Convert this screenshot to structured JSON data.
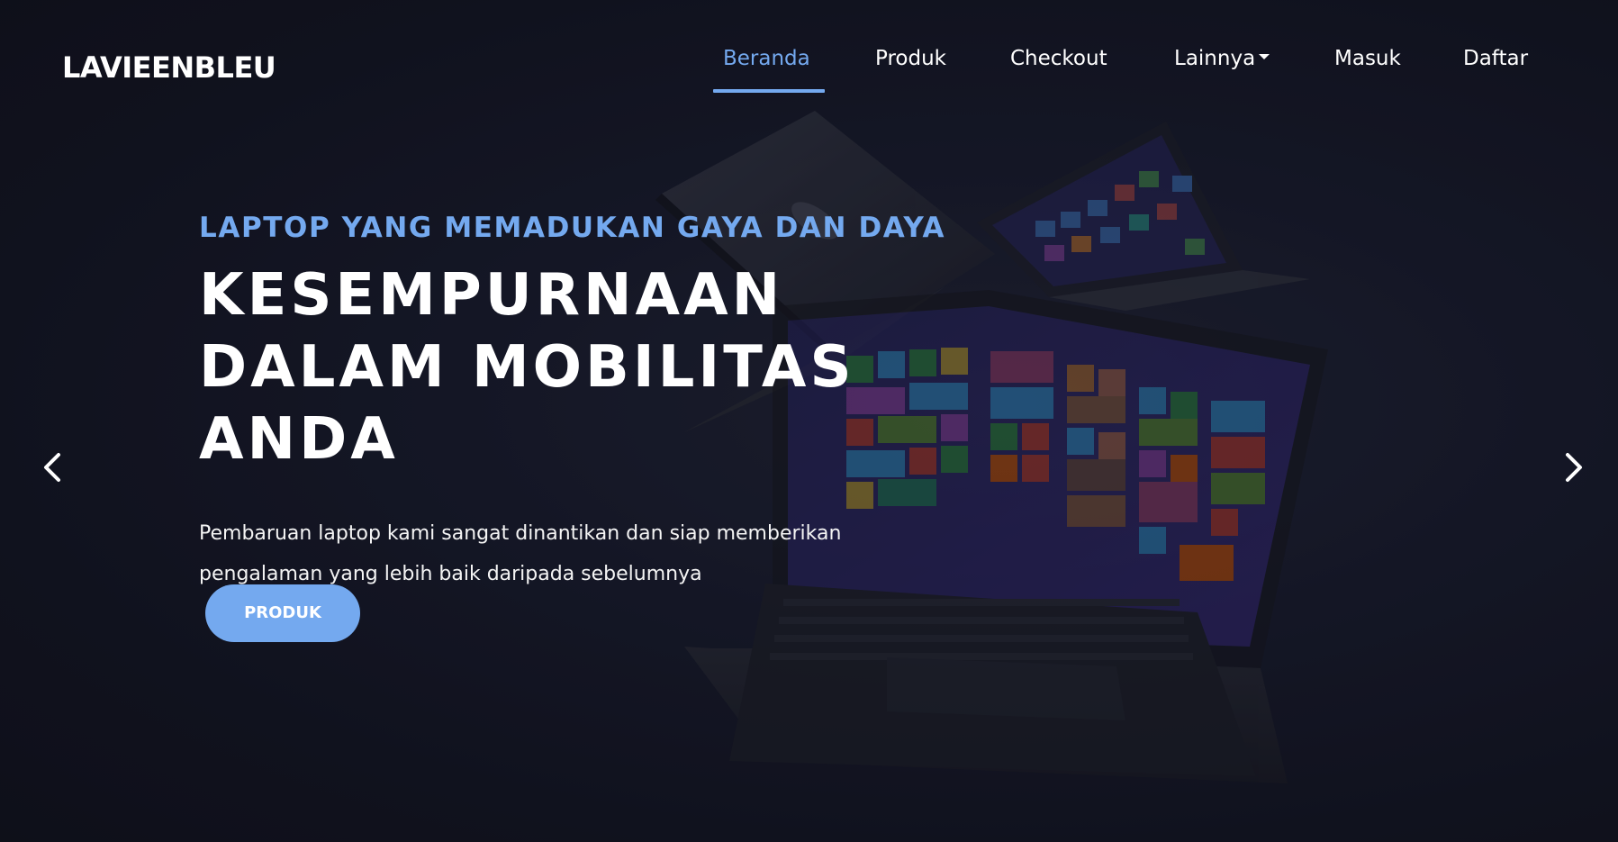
{
  "brand": "LAVIEENBLEU",
  "nav": {
    "items": [
      {
        "label": "Beranda",
        "active": true
      },
      {
        "label": "Produk",
        "active": false
      },
      {
        "label": "Checkout",
        "active": false
      },
      {
        "label": "Lainnya",
        "active": false,
        "dropdown": true
      },
      {
        "label": "Masuk",
        "active": false
      },
      {
        "label": "Daftar",
        "active": false
      }
    ]
  },
  "hero": {
    "subtitle": "LAPTOP YANG MEMADUKAN GAYA DAN DAYA",
    "title": "KESEMPURNAAN DALAM MOBILITAS ANDA",
    "description": "Pembaruan laptop kami sangat dinantikan dan siap memberikan pengalaman yang lebih baik daripada sebelumnya",
    "button_label": "PRODUK"
  },
  "carousel": {
    "prev_icon": "chevron-left-icon",
    "next_icon": "chevron-right-icon"
  },
  "colors": {
    "accent": "#74a9ef",
    "background": "#121522",
    "text": "#ffffff"
  }
}
